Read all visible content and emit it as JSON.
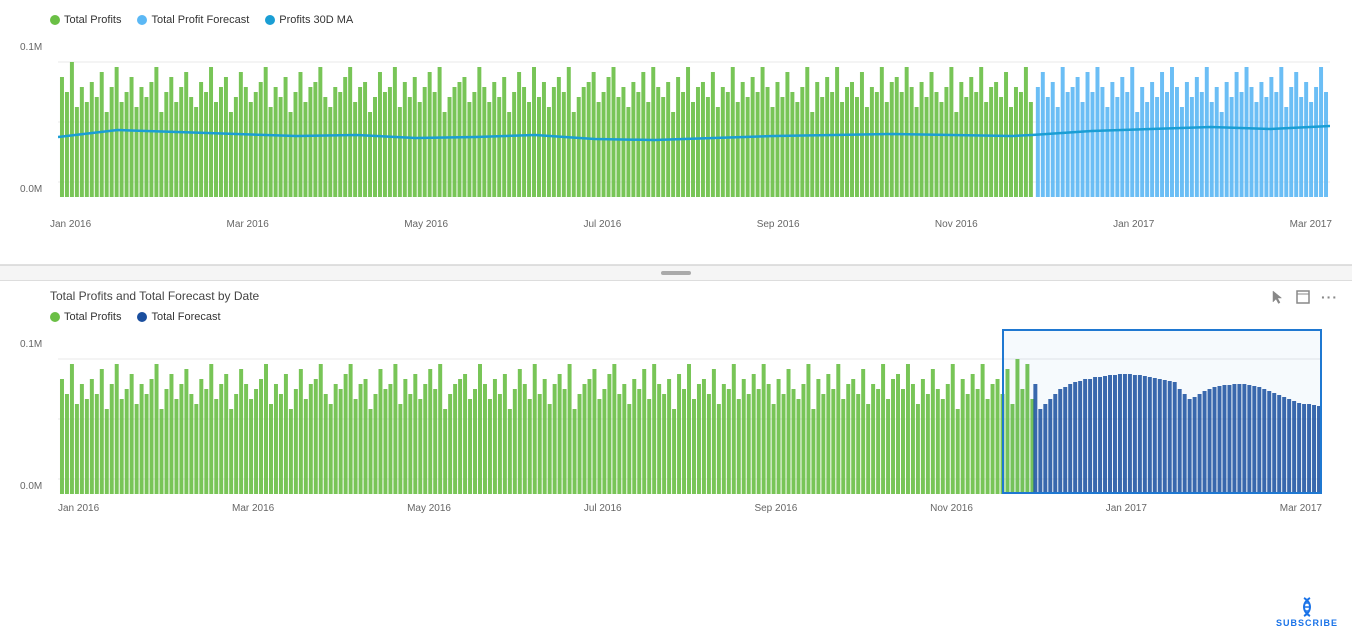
{
  "top_chart": {
    "legend": [
      {
        "label": "Total Profits",
        "color": "#6abf45",
        "type": "dot"
      },
      {
        "label": "Total Profit Forecast",
        "color": "#5bb8f5",
        "type": "dot"
      },
      {
        "label": "Profits 30D MA",
        "color": "#1a9ed4",
        "type": "line"
      }
    ],
    "y_axis": {
      "top": "0.1M",
      "bottom": "0.0M"
    },
    "x_axis": [
      "Jan 2016",
      "Mar 2016",
      "May 2016",
      "Jul 2016",
      "Sep 2016",
      "Nov 2016",
      "Jan 2017",
      "Mar 2017"
    ]
  },
  "bottom_chart": {
    "title": "Total Profits and Total Forecast by Date",
    "legend": [
      {
        "label": "Total Profits",
        "color": "#6abf45"
      },
      {
        "label": "Total Forecast",
        "color": "#1a4e9e"
      }
    ],
    "y_axis": {
      "top": "0.1M",
      "bottom": "0.0M"
    },
    "x_axis": [
      "Jan 2016",
      "Mar 2016",
      "May 2016",
      "Jul 2016",
      "Sep 2016",
      "Nov 2016",
      "Jan 2017",
      "Mar 2017"
    ]
  },
  "icons": {
    "expand": "⊡",
    "more": "···",
    "cursor": "▷"
  },
  "subscribe": {
    "label": "SUBSCRIBE"
  }
}
